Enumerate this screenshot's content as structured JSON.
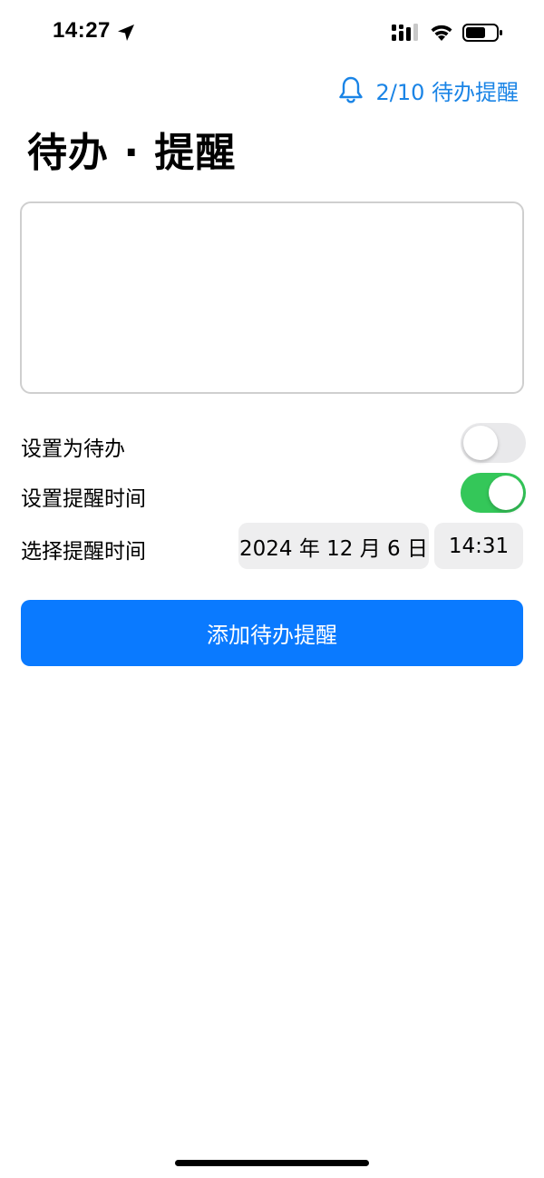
{
  "status_bar": {
    "time": "14:27",
    "icons": [
      "location-arrow-icon",
      "cellular-signal-icon",
      "wifi-icon",
      "battery-icon"
    ]
  },
  "header": {
    "reminder_icon": "bell-icon",
    "reminder_label": "2/10 待办提醒"
  },
  "title": "待办 · 提醒",
  "input": {
    "value": "",
    "placeholder": ""
  },
  "settings": {
    "todo_toggle": {
      "label": "设置为待办",
      "on": false
    },
    "reminder_toggle": {
      "label": "设置提醒时间",
      "on": true
    },
    "reminder_time": {
      "label": "选择提醒时间",
      "date": "2024 年 12 月 6 日",
      "time": "14:31"
    }
  },
  "add_button_label": "添加待办提醒",
  "colors": {
    "accent": "#0a7aff",
    "link": "#1a84e6",
    "toggle_on": "#34c759",
    "toggle_off": "#e9e9eb",
    "pill_bg": "#eeeeef"
  }
}
